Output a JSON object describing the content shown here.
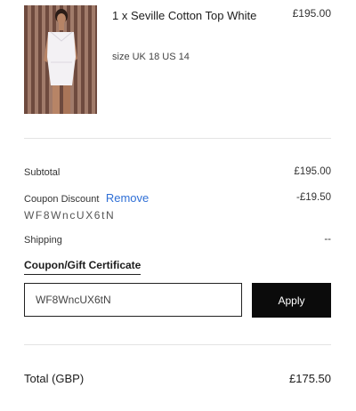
{
  "product": {
    "name": "1 x Seville Cotton Top White",
    "size": "size UK 18 US 14",
    "price": "£195.00"
  },
  "summary": {
    "subtotal_label": "Subtotal",
    "subtotal_value": "£195.00",
    "coupon_label": "Coupon Discount",
    "remove_label": "Remove",
    "coupon_code": "WF8WncUX6tN",
    "coupon_value": "-£19.50",
    "shipping_label": "Shipping",
    "shipping_value": "--"
  },
  "coupon_form": {
    "heading": "Coupon/Gift Certificate",
    "input_value": "WF8WncUX6tN",
    "apply_label": "Apply"
  },
  "total": {
    "label": "Total (GBP)",
    "value": "£175.50"
  },
  "colors": {
    "link": "#2f6fd6",
    "button_bg": "#0b0b0b"
  }
}
